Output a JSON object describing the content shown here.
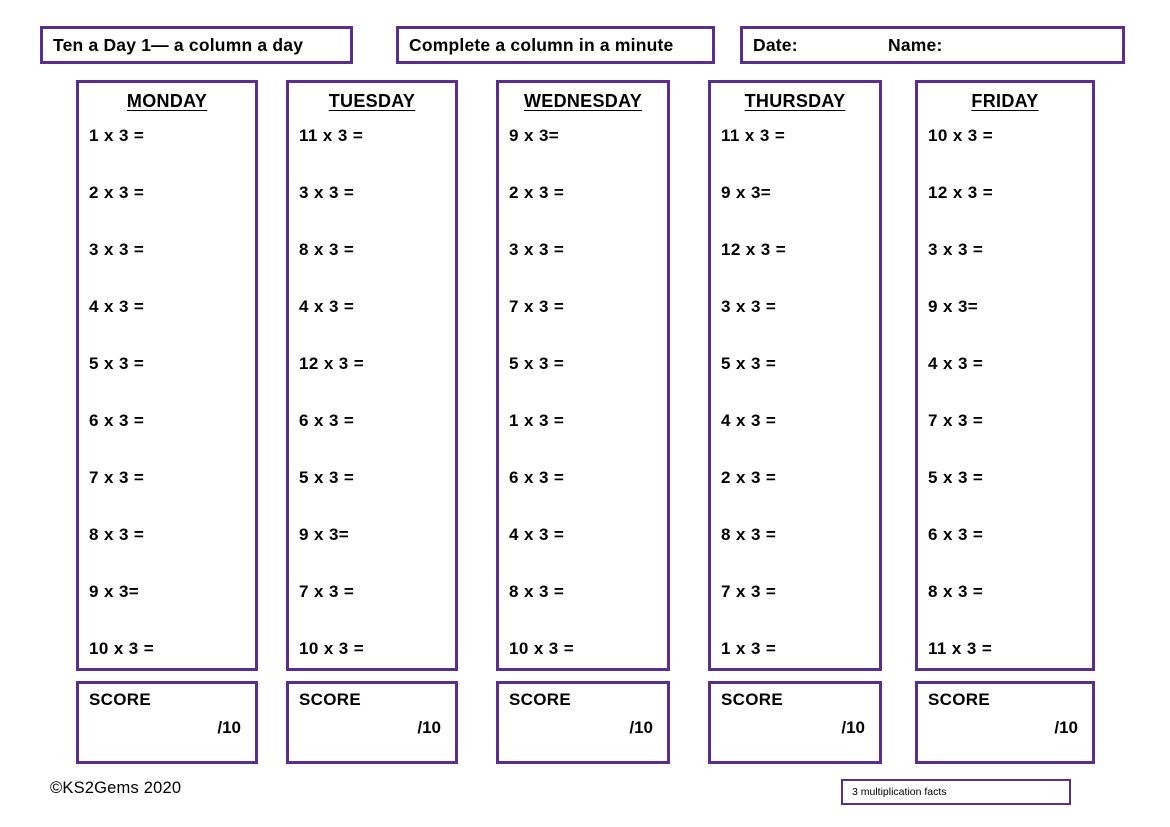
{
  "header": {
    "title": "Ten a Day 1— a column a day",
    "instruction": "Complete a column in a minute",
    "date_label": "Date:",
    "name_label": "Name:"
  },
  "columns": [
    {
      "day": "MONDAY",
      "questions": [
        "1 x 3 =",
        "2 x 3 =",
        "3 x 3 =",
        "4 x 3 =",
        "5 x 3 =",
        "6 x 3 =",
        "7 x 3 =",
        "8 x 3 =",
        "9 x 3=",
        "10 x 3 ="
      ],
      "score_label": "SCORE",
      "score_out_of": "/10"
    },
    {
      "day": "TUESDAY",
      "questions": [
        "11 x 3 =",
        "3 x 3 =",
        "8 x 3 =",
        "4 x 3 =",
        "12 x 3 =",
        "6 x 3 =",
        "5 x 3 =",
        "9 x 3=",
        "7 x 3 =",
        "10 x 3 ="
      ],
      "score_label": "SCORE",
      "score_out_of": "/10"
    },
    {
      "day": "WEDNESDAY",
      "questions": [
        "9 x 3=",
        "2 x 3 =",
        "3 x 3 =",
        "7 x 3 =",
        "5 x 3 =",
        "1 x 3 =",
        "6 x 3 =",
        "4 x 3 =",
        "8 x 3 =",
        "10 x 3 ="
      ],
      "score_label": "SCORE",
      "score_out_of": "/10"
    },
    {
      "day": "THURSDAY",
      "questions": [
        "11 x 3 =",
        "9 x 3=",
        "12 x 3 =",
        "3 x 3 =",
        "5 x 3 =",
        "4 x 3 =",
        "2 x 3 =",
        "8 x 3 =",
        "7 x 3 =",
        "1 x 3 ="
      ],
      "score_label": "SCORE",
      "score_out_of": "/10"
    },
    {
      "day": "FRIDAY",
      "questions": [
        "10 x 3 =",
        "12 x 3 =",
        "3 x 3 =",
        "9 x 3=",
        "4 x 3 =",
        "7 x 3 =",
        "5 x 3 =",
        "6 x 3 =",
        "8 x 3 =",
        "11 x 3 ="
      ],
      "score_label": "SCORE",
      "score_out_of": "/10"
    }
  ],
  "footer": {
    "copyright": "©KS2Gems 2020",
    "facts_tag": "3 multiplication facts"
  },
  "colors": {
    "border_purple": "#5b2d8e",
    "page_background": "#ffffff",
    "text": "#000000"
  }
}
